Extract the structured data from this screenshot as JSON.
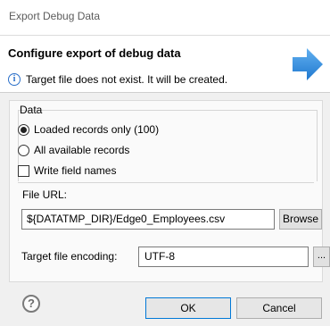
{
  "window": {
    "title": "Export Debug Data"
  },
  "header": {
    "heading": "Configure export of debug data",
    "message": "Target file does not exist. It will be created.",
    "info_icon": "i"
  },
  "data_group": {
    "label": "Data",
    "options": [
      {
        "label": "Loaded records only (100)",
        "checked": true
      },
      {
        "label": "All available records",
        "checked": false
      }
    ],
    "write_field_names": {
      "label": "Write field names",
      "checked": false
    }
  },
  "file_url": {
    "label": "File URL:",
    "value": "${DATATMP_DIR}/Edge0_Employees.csv",
    "browse_label": "Browse"
  },
  "encoding": {
    "label": "Target file encoding:",
    "value": "UTF-8",
    "button_label": "..."
  },
  "footer": {
    "help_label": "?",
    "ok_label": "OK",
    "cancel_label": "Cancel"
  },
  "colors": {
    "accent": "#2a7fd6",
    "ok_border": "#0078d7"
  },
  "icons": {
    "header_arrow": "right-arrow-icon",
    "help": "help-icon",
    "info": "info-icon"
  }
}
